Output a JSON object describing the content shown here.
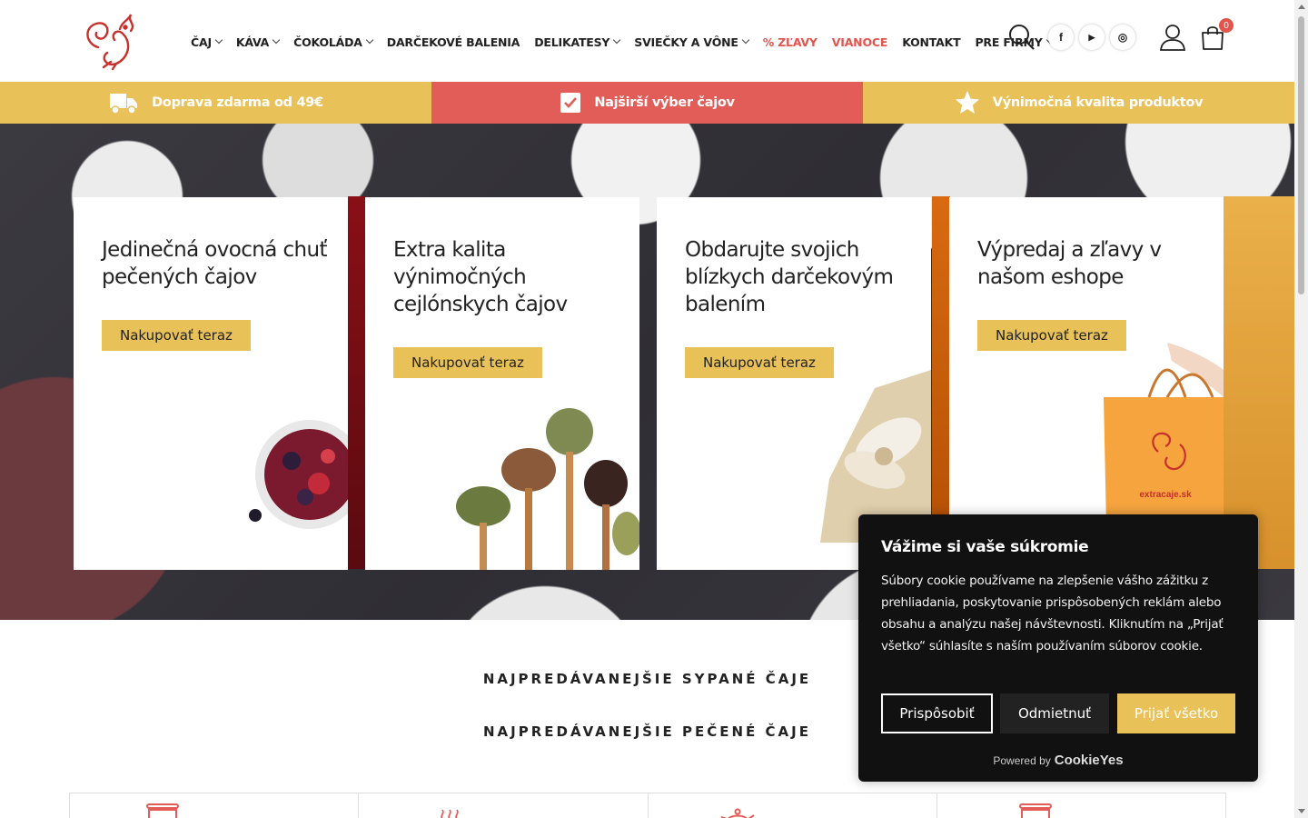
{
  "header": {
    "logo_name": "squirrel-logo",
    "nav": [
      {
        "label": "ČAJ",
        "dropdown": true,
        "highlight": false
      },
      {
        "label": "KÁVA",
        "dropdown": true,
        "highlight": false
      },
      {
        "label": "ČOKOLÁDA",
        "dropdown": true,
        "highlight": false
      },
      {
        "label": "DARČEKOVÉ BALENIA",
        "dropdown": false,
        "highlight": false
      },
      {
        "label": "DELIKATESY",
        "dropdown": true,
        "highlight": false
      },
      {
        "label": "SVIEČKY A VÔNE",
        "dropdown": true,
        "highlight": false
      },
      {
        "label": "% ZĽAVY",
        "dropdown": false,
        "highlight": true
      },
      {
        "label": "VIANOCE",
        "dropdown": false,
        "highlight": true
      },
      {
        "label": "KONTAKT",
        "dropdown": false,
        "highlight": false
      },
      {
        "label": "PRE FIRMY",
        "dropdown": true,
        "highlight": false
      }
    ],
    "social": [
      {
        "name": "facebook-icon",
        "glyph": "f"
      },
      {
        "name": "youtube-icon",
        "glyph": "▶"
      },
      {
        "name": "instagram-icon",
        "glyph": "◎"
      }
    ],
    "cart_count": "0"
  },
  "benefits": [
    {
      "label": "Doprava zdarma od 49€",
      "icon": "delivery-truck-icon"
    },
    {
      "label": "Najširší výber čajov",
      "icon": "checkbox-icon"
    },
    {
      "label": "Výnimočná kvalita produktov",
      "icon": "star-icon"
    }
  ],
  "hero_cards": [
    {
      "title": "Jedinečná ovocná chuť pečených čajov",
      "cta": "Nakupovať teraz",
      "image": "fruit-jar-image"
    },
    {
      "title": "Extra kalita výnimočných cejlónskych čajov",
      "cta": "Nakupovať teraz",
      "image": "tea-spoons-image"
    },
    {
      "title": "Obdarujte svojich blízkych darčekovým balením",
      "cta": "Nakupovať teraz",
      "image": "gift-bow-image"
    },
    {
      "title": "Výpredaj a zľavy v našom eshope",
      "cta": "Nakupovať teraz",
      "image": "shopping-bag-image",
      "bag_text": "extracaje.sk"
    }
  ],
  "sections": {
    "loose_teas": "NAJPREDÁVANEJŠIE SYPANÉ ČAJE",
    "baked_teas": "NAJPREDÁVANEJŠIE PEČENÉ ČAJE"
  },
  "cookie": {
    "title": "Vážime si vaše súkromie",
    "text": "Súbory cookie používame na zlepšenie vášho zážitku z prehliadania, poskytovanie prispôsobených reklám alebo obsahu a analýzu našej návštevnosti. Kliknutím na „Prijať všetko“ súhlasíte s naším používaním súborov cookie.",
    "customize": "Prispôsobiť",
    "reject": "Odmietnuť",
    "accept": "Prijať všetko",
    "powered_by": "Powered by",
    "brand": "CookieYes"
  },
  "colors": {
    "accent_yellow": "#e9c159",
    "accent_red": "#e25d57",
    "dark": "#111111"
  }
}
